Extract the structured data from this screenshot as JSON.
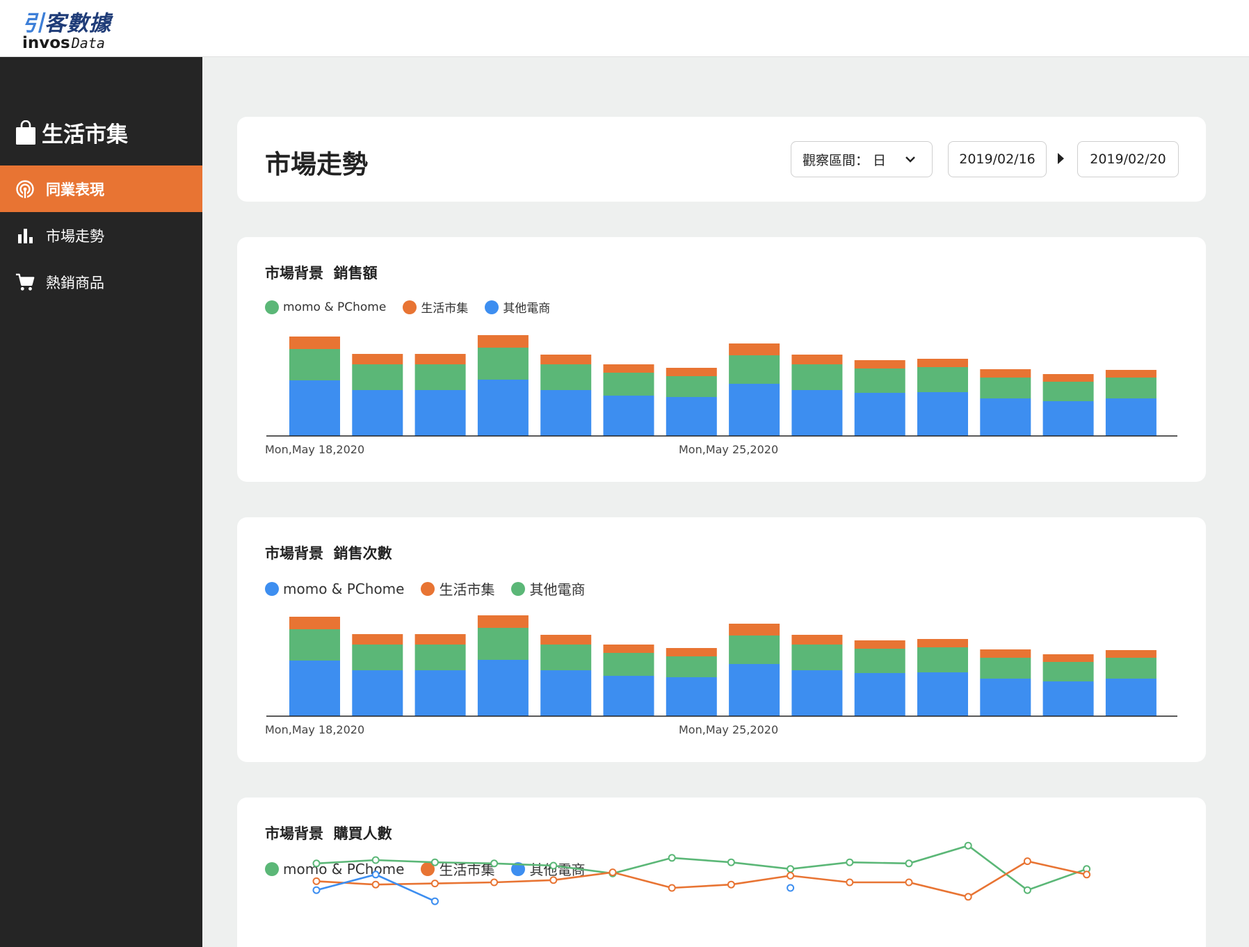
{
  "logo": {
    "cn_part1": "引",
    "cn_part2": "客數據",
    "en_bold": "invos",
    "en_mono": "Data"
  },
  "sidebar": {
    "store_name": "生活市集",
    "items": [
      {
        "label": "同業表現",
        "icon": "radar-icon",
        "active": true
      },
      {
        "label": "市場走勢",
        "icon": "bar-chart-icon",
        "active": false
      },
      {
        "label": "熱銷商品",
        "icon": "cart-icon",
        "active": false
      }
    ]
  },
  "header": {
    "title": "市場走勢",
    "period_label": "觀察區間：",
    "period_value": "日",
    "start_date": "2019/02/16",
    "end_date": "2019/02/20"
  },
  "colors": {
    "green": "#5bb777",
    "orange": "#e87433",
    "blue": "#3d8ef0",
    "accent": "#e87433",
    "sidebar": "#252525"
  },
  "chart_data": [
    {
      "type": "bar",
      "stacked": true,
      "title": "市場背景  銷售額",
      "legend": [
        {
          "name": "momo & PChome",
          "color": "#5bb777"
        },
        {
          "name": "生活市集",
          "color": "#e87433"
        },
        {
          "name": "其他電商",
          "color": "#3d8ef0"
        }
      ],
      "tick_labels": [
        "Mon,May 18,2020",
        "Mon,May 25,2020"
      ],
      "tick_positions": [
        0,
        7
      ],
      "ylim": [
        0,
        150
      ],
      "series": [
        {
          "name": "blue",
          "color": "#3d8ef0",
          "values": [
            80,
            66,
            66,
            81,
            66,
            58,
            56,
            75,
            66,
            62,
            63,
            54,
            50,
            54
          ]
        },
        {
          "name": "green",
          "color": "#5bb777",
          "values": [
            45,
            37,
            37,
            46,
            37,
            33,
            30,
            41,
            37,
            35,
            36,
            30,
            28,
            30
          ]
        },
        {
          "name": "orange",
          "color": "#e87433",
          "values": [
            18,
            15,
            15,
            18,
            14,
            12,
            12,
            17,
            14,
            12,
            12,
            12,
            11,
            11
          ]
        }
      ]
    },
    {
      "type": "bar",
      "stacked": true,
      "title": "市場背景  銷售次數",
      "legend": [
        {
          "name": "momo & PChome",
          "color": "#3d8ef0"
        },
        {
          "name": "生活市集",
          "color": "#e87433"
        },
        {
          "name": "其他電商",
          "color": "#5bb777"
        }
      ],
      "tick_labels": [
        "Mon,May 18,2020",
        "Mon,May 25,2020"
      ],
      "tick_positions": [
        0,
        7
      ],
      "ylim": [
        0,
        150
      ],
      "series": [
        {
          "name": "blue",
          "color": "#3d8ef0",
          "values": [
            80,
            66,
            66,
            81,
            66,
            58,
            56,
            75,
            66,
            62,
            63,
            54,
            50,
            54
          ]
        },
        {
          "name": "green",
          "color": "#5bb777",
          "values": [
            45,
            37,
            37,
            46,
            37,
            33,
            30,
            41,
            37,
            35,
            36,
            30,
            28,
            30
          ]
        },
        {
          "name": "orange",
          "color": "#e87433",
          "values": [
            18,
            15,
            15,
            18,
            14,
            12,
            12,
            17,
            14,
            12,
            12,
            12,
            11,
            11
          ]
        }
      ]
    },
    {
      "type": "line",
      "title": "市場背景  購買人數",
      "legend": [
        {
          "name": "momo & PChome",
          "color": "#5bb777"
        },
        {
          "name": "生活市集",
          "color": "#e87433"
        },
        {
          "name": "其他電商",
          "color": "#3d8ef0"
        }
      ],
      "ylim": [
        0,
        100
      ],
      "series": [
        {
          "name": "green",
          "color": "#5bb777",
          "values": [
            72,
            75,
            73,
            72,
            70,
            63,
            77,
            73,
            67,
            73,
            72,
            88,
            48,
            67
          ]
        },
        {
          "name": "orange",
          "color": "#e87433",
          "values": [
            56,
            53,
            54,
            55,
            57,
            64,
            50,
            53,
            61,
            55,
            55,
            42,
            74,
            62
          ]
        },
        {
          "name": "blue",
          "color": "#3d8ef0",
          "values": [
            48,
            62,
            38,
            null,
            null,
            null,
            null,
            null,
            50,
            null,
            null,
            null,
            null,
            null
          ]
        }
      ]
    }
  ]
}
